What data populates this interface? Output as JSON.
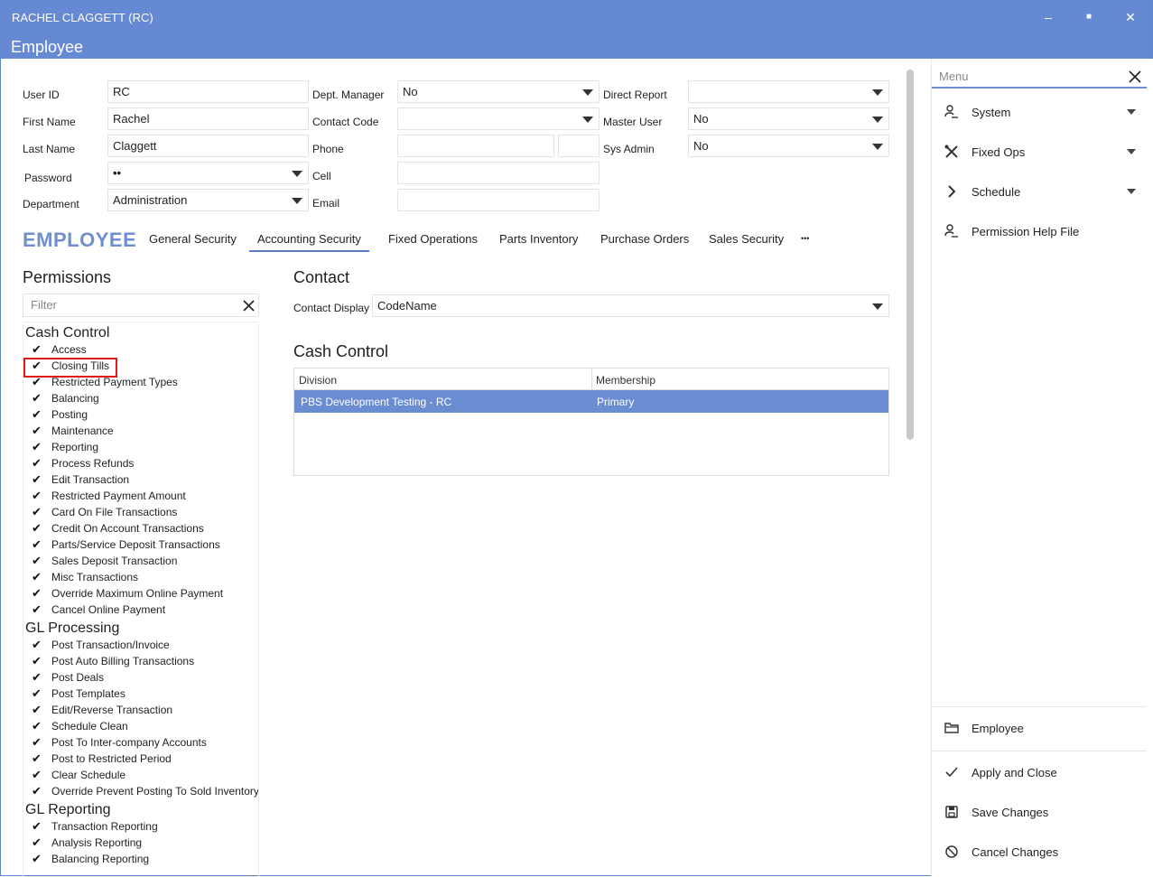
{
  "window": {
    "user_title": "RACHEL CLAGGETT (RC)",
    "screen_title": "Employee",
    "controls": {
      "minimize": "–",
      "maximize": "■",
      "close": "✕"
    }
  },
  "form": {
    "user_id": {
      "label": "User ID",
      "value": "RC"
    },
    "first_name": {
      "label": "First Name",
      "value": "Rachel"
    },
    "last_name": {
      "label": "Last Name",
      "value": "Claggett"
    },
    "password": {
      "label": "Password",
      "value": "••"
    },
    "department": {
      "label": "Department",
      "value": "Administration"
    },
    "dept_manager": {
      "label": "Dept. Manager",
      "value": "No"
    },
    "contact_code": {
      "label": "Contact Code",
      "value": ""
    },
    "phone": {
      "label": "Phone",
      "value": "",
      "ext": ""
    },
    "cell": {
      "label": "Cell",
      "value": ""
    },
    "email": {
      "label": "Email",
      "value": ""
    },
    "direct_report": {
      "label": "Direct Report",
      "value": ""
    },
    "master_user": {
      "label": "Master User",
      "value": "No"
    },
    "sys_admin": {
      "label": "Sys Admin",
      "value": "No"
    }
  },
  "tabs": {
    "heading": "EMPLOYEE",
    "items": [
      "General Security",
      "Accounting Security",
      "Fixed Operations",
      "Parts Inventory",
      "Purchase Orders",
      "Sales Security"
    ],
    "active": "Accounting Security",
    "more": "•••"
  },
  "permissions": {
    "title": "Permissions",
    "filter_placeholder": "Filter",
    "highlighted_item": "Closing Tills",
    "groups": [
      {
        "name": "Cash Control",
        "items": [
          "Access",
          "Closing Tills",
          "Restricted Payment Types",
          "Balancing",
          "Posting",
          "Maintenance",
          "Reporting",
          "Process Refunds",
          "Edit Transaction",
          "Restricted Payment Amount",
          "Card On File Transactions",
          "Credit On Account Transactions",
          "Parts/Service Deposit Transactions",
          "Sales Deposit Transaction",
          "Misc Transactions",
          "Override Maximum Online Payment",
          "Cancel Online Payment"
        ]
      },
      {
        "name": "GL Processing",
        "items": [
          "Post Transaction/Invoice",
          "Post Auto Billing Transactions",
          "Post Deals",
          "Post Templates",
          "Edit/Reverse Transaction",
          "Schedule Clean",
          "Post To Inter-company Accounts",
          "Post to Restricted Period",
          "Clear Schedule",
          "Override Prevent Posting To Sold Inventory"
        ]
      },
      {
        "name": "GL Reporting",
        "items": [
          "Transaction Reporting",
          "Analysis Reporting",
          "Balancing Reporting"
        ]
      }
    ]
  },
  "contact": {
    "title": "Contact",
    "display_label": "Contact Display",
    "display_value": "CodeName"
  },
  "cash_control": {
    "title": "Cash Control",
    "columns": [
      "Division",
      "Membership"
    ],
    "rows": [
      [
        "PBS Development Testing - RC",
        "Primary"
      ]
    ]
  },
  "side_menu": {
    "search_placeholder": "Menu",
    "items": [
      {
        "label": "System",
        "icon": "user-key-icon",
        "dropdown": true
      },
      {
        "label": "Fixed Ops",
        "icon": "tools-icon",
        "dropdown": true
      },
      {
        "label": "Schedule",
        "icon": "chevron-right-icon",
        "dropdown": true
      },
      {
        "label": "Permission Help File",
        "icon": "user-key-icon",
        "dropdown": false
      }
    ],
    "bottom": [
      {
        "label": "Employee",
        "icon": "folder-icon"
      },
      {
        "label": "Apply and Close",
        "icon": "check-icon"
      },
      {
        "label": "Save Changes",
        "icon": "save-icon"
      },
      {
        "label": "Cancel Changes",
        "icon": "cancel-icon"
      }
    ]
  }
}
